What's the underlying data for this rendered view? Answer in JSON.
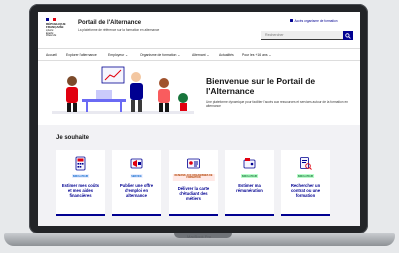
{
  "device": {
    "model_label": "MacBook Pro"
  },
  "header": {
    "gov_logo_lines": [
      "RÉPUBLIQUE",
      "FRANÇAISE",
      "Liberté",
      "Égalité",
      "Fraternité"
    ],
    "portal_title": "Portail de l'Alternance",
    "portal_subtitle": "La plateforme de référence sur la formation en alternance",
    "access_link": "Accès organisme de formation",
    "search_placeholder": "Rechercher"
  },
  "nav": {
    "items": [
      "Accueil",
      "Explorer l'alternance",
      "Employeur",
      "Organisme de formation",
      "Alternant",
      "Actualités",
      "Pour les +16 ans"
    ]
  },
  "hero": {
    "title": "Bienvenue sur le Portail de l'Alternance",
    "text": "Une plateforme dynamique pour faciliter l'accès aux ressources et services autour de la formation en alternance"
  },
  "section": {
    "title": "Je souhaite",
    "cards": [
      {
        "badge": "SIMULATEUR",
        "label": "Estimer mes coûts et mes aides financières",
        "pict": "calculator-icon"
      },
      {
        "badge": "SERVICE",
        "label": "Publier une offre d'emploi en alternance",
        "pict": "megaphone-icon"
      },
      {
        "badge": "RESERVE AUX ORGANISMES DE FORMATION",
        "label": "Délivrer la carte d'étudiant des métiers",
        "pict": "id-card-icon"
      },
      {
        "badge": "SIMULATEUR",
        "label": "Estimer ma rémunération",
        "pict": "wallet-icon"
      },
      {
        "badge": "SIMULATEUR",
        "label": "Rechercher un contrat ou une formation",
        "pict": "document-search-icon"
      }
    ]
  },
  "colors": {
    "primary_blue": "#000091",
    "marianne_red": "#e1000f",
    "hero_accent": "#e1000f"
  }
}
